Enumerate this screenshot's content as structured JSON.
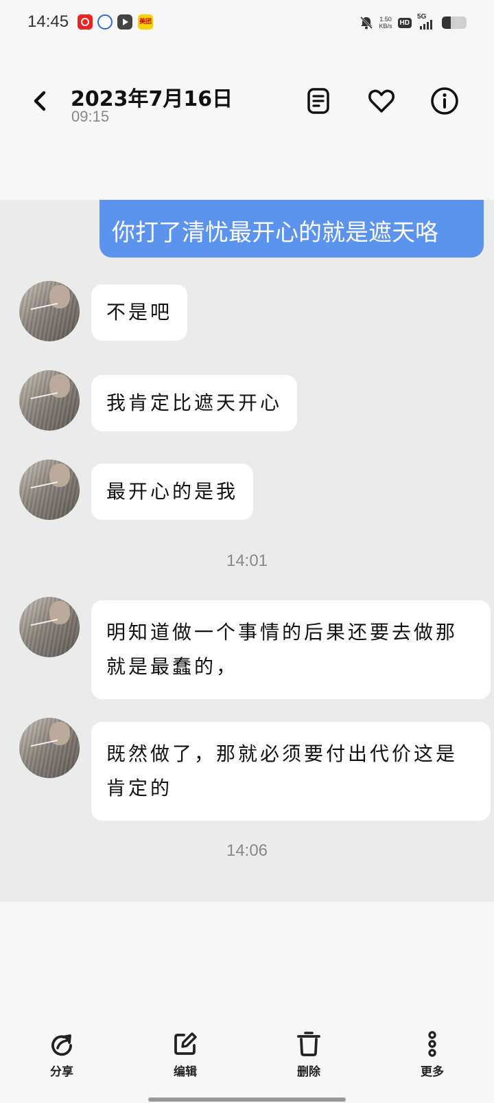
{
  "status_bar": {
    "time": "14:45",
    "apps": [
      "netease-music-icon",
      "baidu-icon",
      "video-player-icon",
      "meituan-icon"
    ],
    "meituan_label": "美团",
    "speed_value": "1.50",
    "speed_unit": "KB/s",
    "hd_label": "HD",
    "network_label": "5G",
    "battery_level": 0.35
  },
  "header": {
    "title": "2023年7月16日",
    "subtitle": "09:15"
  },
  "conversation": {
    "sent_message": "你打了清忧最开心的就是遮天咯",
    "messages": [
      {
        "text": "不是吧"
      },
      {
        "text": "我肯定比遮天开心"
      },
      {
        "text": "最开心的是我"
      },
      {
        "text": "明知道做一个事情的后果还要去做那就是最蠢的，"
      },
      {
        "text": "既然做了，那就必须要付出代价这是肯定的"
      }
    ],
    "timestamps": [
      "14:01",
      "14:06"
    ]
  },
  "toolbar": {
    "share_label": "分享",
    "edit_label": "编辑",
    "delete_label": "删除",
    "more_label": "更多"
  },
  "colors": {
    "sent_bubble": "#5b93ee",
    "background": "#f7f7f7",
    "chat_background": "#ebebeb"
  }
}
